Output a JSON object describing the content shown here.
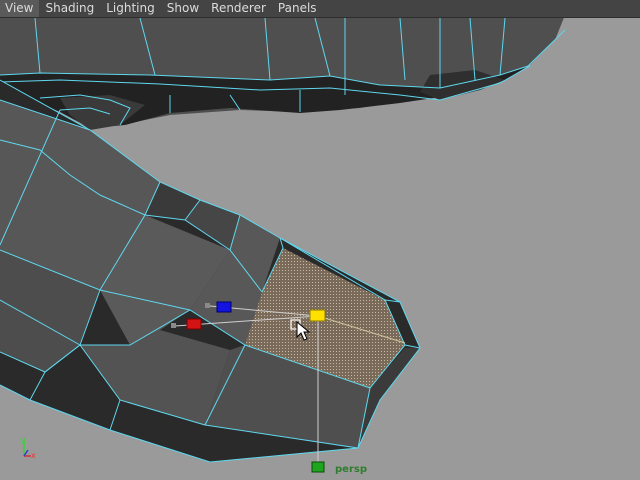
{
  "menubar": {
    "items": [
      "View",
      "Shading",
      "Lighting",
      "Show",
      "Renderer",
      "Panels"
    ]
  },
  "viewport": {
    "camera_name": "persp",
    "axis_labels": {
      "x": "x",
      "y": "y"
    }
  },
  "colors": {
    "background": "#9a9a9a",
    "mesh_face": "#4f4f4f",
    "mesh_dark": "#2a2a2a",
    "wireframe": "#5fd7ee",
    "selected_face": "#7c6e60",
    "manip_x": "#d41414",
    "manip_y": "#1da51d",
    "manip_z": "#1414e0",
    "manip_center": "#ffe000",
    "camera_label": "#2e7d2e"
  },
  "icons": [
    "axis-gizmo-icon",
    "move-manipulator-icon",
    "mouse-cursor-icon"
  ]
}
